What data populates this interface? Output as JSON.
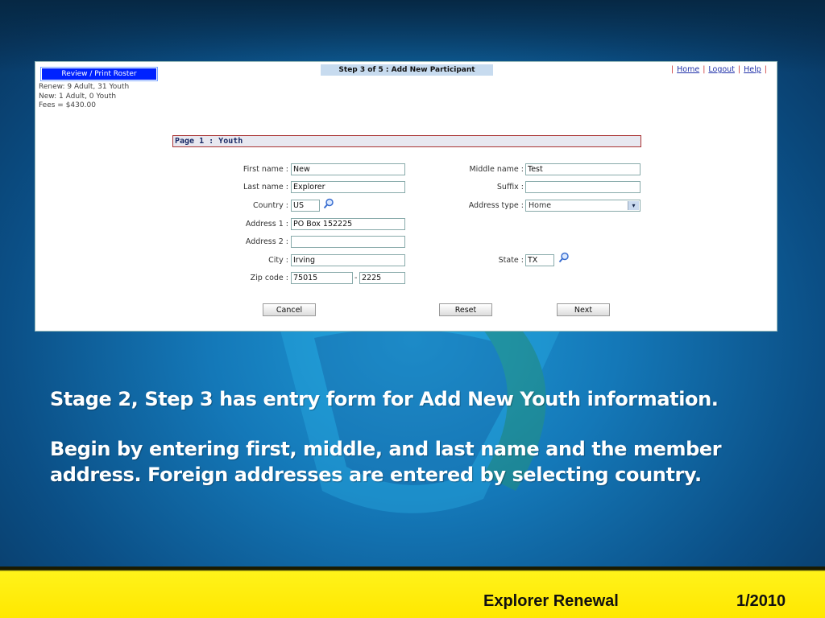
{
  "app": {
    "roster_button": "Review / Print Roster",
    "summary": [
      "Renew: 9 Adult, 31 Youth",
      "New: 1 Adult, 0 Youth",
      "Fees = $430.00"
    ],
    "step_title": "Step 3 of 5 : Add New Participant",
    "links": [
      "Home",
      "Logout",
      "Help"
    ],
    "section_title": "Page 1 : Youth"
  },
  "form": {
    "first_name": {
      "label": "First name :",
      "value": "New"
    },
    "middle_name": {
      "label": "Middle name :",
      "value": "Test"
    },
    "last_name": {
      "label": "Last name :",
      "value": "Explorer"
    },
    "suffix": {
      "label": "Suffix :",
      "value": ""
    },
    "country": {
      "label": "Country :",
      "value": "US"
    },
    "address_type": {
      "label": "Address type :",
      "value": "Home"
    },
    "address1": {
      "label": "Address 1 :",
      "value": "PO Box 152225"
    },
    "address2": {
      "label": "Address 2 :",
      "value": ""
    },
    "city": {
      "label": "City :",
      "value": "Irving"
    },
    "state": {
      "label": "State :",
      "value": "TX"
    },
    "zip": {
      "label": "Zip code :",
      "value": "75015",
      "ext": "2225",
      "dash": "-"
    }
  },
  "buttons": {
    "cancel": "Cancel",
    "reset": "Reset",
    "next": "Next"
  },
  "captions": [
    "Stage 2, Step 3 has entry form for Add New Youth information.",
    "Begin by entering first, middle, and last name and the member address.  Foreign addresses are entered by selecting country."
  ],
  "footer": {
    "title": "Explorer Renewal",
    "date": "1/2010"
  },
  "colors": {
    "slide_blue": "#1478b8",
    "footer_yellow": "#ffe800",
    "roster_button_blue": "#0022ff",
    "step_banner": "#c7dbef"
  }
}
